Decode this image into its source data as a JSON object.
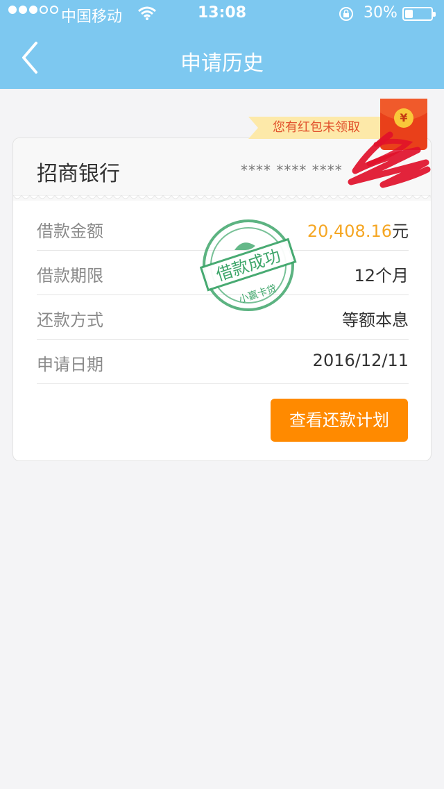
{
  "status_bar": {
    "carrier": "中国移动",
    "time": "13:08",
    "battery_percent": "30%",
    "battery_level": 0.3,
    "signal_bars_filled": 3,
    "signal_bars_total": 5
  },
  "nav": {
    "title": "申请历史",
    "back_icon": "chevron-left-icon"
  },
  "promo": {
    "banner_text": "您有红包未领取",
    "coin_symbol": "¥"
  },
  "card": {
    "bank_name": "招商银行",
    "card_number_masked": "**** **** ****"
  },
  "details": [
    {
      "label": "借款金额",
      "value": "20,408.16",
      "unit": "元"
    },
    {
      "label": "借款期限",
      "value": "12个月"
    },
    {
      "label": "还款方式",
      "value": "等额本息"
    },
    {
      "label": "申请日期",
      "value": "2016/12/11"
    }
  ],
  "stamp": {
    "main_text": "借款成功",
    "sub_text": "小赢卡贷"
  },
  "actions": {
    "view_plan_label": "查看还款计划"
  },
  "colors": {
    "header_bg": "#7dc8f0",
    "amount": "#f5a623",
    "button_bg": "#ff8a00",
    "stamp": "#3fa66b",
    "redpack": "#e9401a"
  }
}
